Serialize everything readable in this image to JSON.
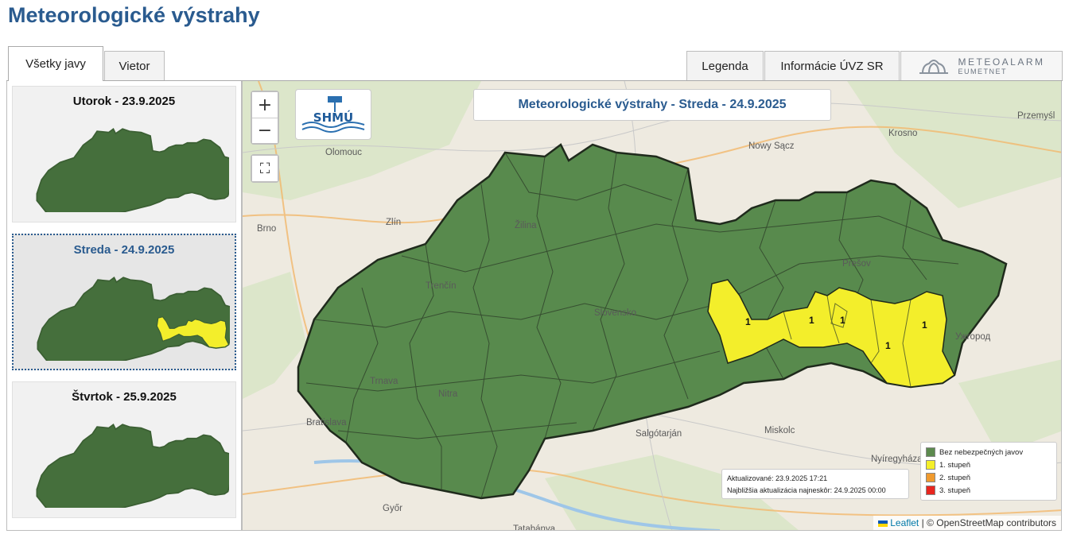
{
  "header": {
    "title": "Meteorologické výstrahy"
  },
  "tabs": {
    "all": "Všetky javy",
    "wind": "Vietor",
    "legend": "Legenda",
    "info": "Informácie ÚVZ SR"
  },
  "meteoalarm": {
    "line1": "METEOALARM",
    "line2": "EUMETNET"
  },
  "days": [
    {
      "title": "Utorok - 23.9.2025"
    },
    {
      "title": "Streda - 24.9.2025"
    },
    {
      "title": "Štvrtok - 25.9.2025"
    }
  ],
  "map": {
    "title": "Meteorologické výstrahy - Streda - 24.9.2025",
    "zoom_in": "+",
    "zoom_out": "−",
    "fullscreen": "⛶",
    "shmu_logo": "SHMÚ",
    "warning_level": "1",
    "cities": {
      "olomouc": "Olomouc",
      "brno": "Brno",
      "zlin": "Zlín",
      "zilina": "Žilina",
      "trencin": "Trenčín",
      "trnava": "Trnava",
      "nitra": "Nitra",
      "bratislava": "Bratislava",
      "gyor": "Győr",
      "tatabanya": "Tatabánya",
      "salgotarjan": "Salgótarján",
      "miskolc": "Miskolc",
      "nyiregyhaza": "Nyíregyháza",
      "uzhhorod": "Ужгород",
      "presov": "Prešov",
      "slovensko": "Slovensko",
      "krosno": "Krosno",
      "nowy_sacz": "Nowy Sącz",
      "przemysl": "Przemyśl"
    },
    "update": {
      "line1": "Aktualizované: 23.9.2025 17:21",
      "line2": "Najbližšia aktualizácia najneskôr: 24.9.2025 00:00"
    },
    "legend": [
      {
        "label": "Bez nebezpečných javov",
        "color": "#5c8a4e"
      },
      {
        "label": "1. stupeň",
        "color": "#f5ef2a"
      },
      {
        "label": "2. stupeň",
        "color": "#f09a2e"
      },
      {
        "label": "3. stupeň",
        "color": "#e8261f"
      }
    ],
    "attribution": {
      "leaflet": "Leaflet",
      "osm": "© OpenStreetMap contributors"
    }
  },
  "colors": {
    "green": "#588a4d",
    "green_dark": "#456f3c",
    "yellow": "#f3ee2b",
    "accent": "#2a5b8f"
  }
}
